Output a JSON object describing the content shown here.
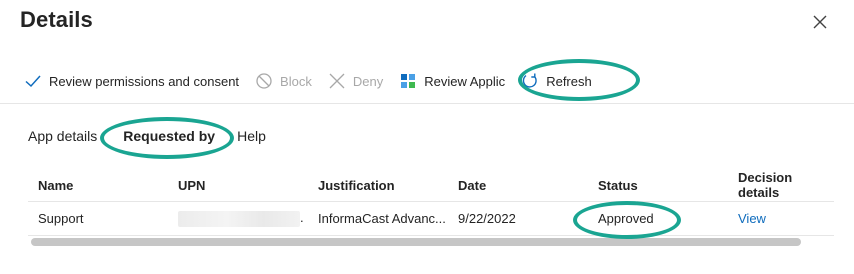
{
  "panel": {
    "title": "Details"
  },
  "toolbar": {
    "review_permissions": "Review permissions and consent",
    "block": "Block",
    "deny": "Deny",
    "review_application": "Review Application",
    "refresh": "Refresh"
  },
  "tabs": [
    {
      "label": "App details",
      "active": false
    },
    {
      "label": "Requested by",
      "active": true
    },
    {
      "label": "Help",
      "active": false
    }
  ],
  "table": {
    "columns": [
      "Name",
      "UPN",
      "Justification",
      "Date",
      "Status",
      "Decision details"
    ],
    "rows": [
      {
        "name": "Support",
        "upn_suffix": ".",
        "justification": "InformaCast Advanc...",
        "date": "9/22/2022",
        "status": "Approved",
        "decision": "View"
      }
    ]
  },
  "colors": {
    "accent": "#0f6cbd",
    "highlight": "#1aa592",
    "disabled": "#a8a8a8"
  },
  "icons": [
    "checkmark-icon",
    "block-icon",
    "deny-icon",
    "app-grid-icon",
    "refresh-icon",
    "close-icon"
  ]
}
